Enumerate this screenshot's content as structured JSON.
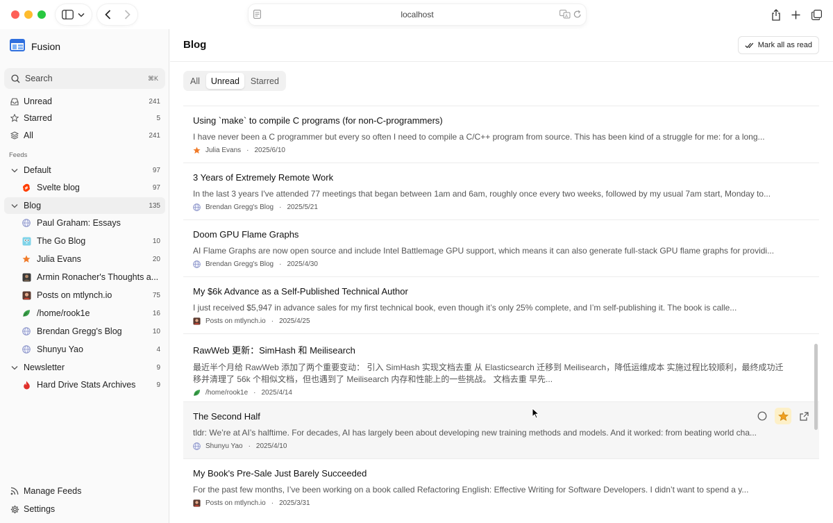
{
  "browser": {
    "url": "localhost"
  },
  "app": {
    "name": "Fusion"
  },
  "search": {
    "label": "Search",
    "shortcut": "⌘K"
  },
  "nav": {
    "unread": {
      "label": "Unread",
      "count": "241"
    },
    "starred": {
      "label": "Starred",
      "count": "5"
    },
    "all": {
      "label": "All",
      "count": "241"
    }
  },
  "feeds_label": "Feeds",
  "groups": [
    {
      "label": "Default",
      "count": "97",
      "feeds": [
        {
          "label": "Svelte blog",
          "count": "97"
        }
      ]
    },
    {
      "label": "Blog",
      "count": "135",
      "feeds": [
        {
          "label": "Paul Graham: Essays",
          "count": ""
        },
        {
          "label": "The Go Blog",
          "count": "10"
        },
        {
          "label": "Julia Evans",
          "count": "20"
        },
        {
          "label": "Armin Ronacher's Thoughts a...",
          "count": ""
        },
        {
          "label": "Posts on mtlynch.io",
          "count": "75"
        },
        {
          "label": "/home/rook1e",
          "count": "16"
        },
        {
          "label": "Brendan Gregg's Blog",
          "count": "10"
        },
        {
          "label": "Shunyu Yao",
          "count": "4"
        }
      ]
    },
    {
      "label": "Newsletter",
      "count": "9",
      "feeds": [
        {
          "label": "Hard Drive Stats Archives",
          "count": "9"
        }
      ]
    }
  ],
  "footer": {
    "manage": "Manage Feeds",
    "settings": "Settings"
  },
  "main": {
    "title": "Blog",
    "mark_all": "Mark all as read",
    "tabs": [
      "All",
      "Unread",
      "Starred"
    ],
    "selected_tab": "Unread"
  },
  "articles": [
    {
      "title": "Using `make` to compile C programs (for non-C-programmers)",
      "summary": "I have never been a C programmer but every so often I need to compile a C/C++ program from source. This has been kind of a struggle for me: for a long...",
      "source": "Julia Evans",
      "date": "2025/6/10"
    },
    {
      "title": "3 Years of Extremely Remote Work",
      "summary": "In the last 3 years I've attended 77 meetings that began between 1am and 6am, roughly once every two weeks, followed by my usual 7am start, Monday to...",
      "source": "Brendan Gregg's Blog",
      "date": "2025/5/21"
    },
    {
      "title": "Doom GPU Flame Graphs",
      "summary": "AI Flame Graphs are now open source and include Intel Battlemage GPU support, which means it can also generate full-stack GPU flame graphs for providi...",
      "source": "Brendan Gregg's Blog",
      "date": "2025/4/30"
    },
    {
      "title": "My $6k Advance as a Self-Published Technical Author",
      "summary": "I just received $5,947 in advance sales for my first technical book, even though it’s only 25% complete, and I’m self-publishing it. The book is calle...",
      "source": "Posts on mtlynch.io",
      "date": "2025/4/25"
    },
    {
      "title": "RawWeb 更新：SimHash 和 Meilisearch",
      "summary": "最近半个月给 RawWeb 添加了两个重要变动： 引入 SimHash 实现文档去重 从 Elasticsearch 迁移到 Meilisearch，降低运维成本 实施过程比较顺利，最终成功迁移并清理了 56k 个相似文档，但也遇到了 Meilisearch 内存和性能上的一些挑战。 文档去重 早先...",
      "source": "/home/rook1e",
      "date": "2025/4/14"
    },
    {
      "title": "The Second Half",
      "summary": "tldr: We’re at AI’s halftime. For decades, AI has largely been about developing new training methods and models. And it worked: from beating world cha...",
      "source": "Shunyu Yao",
      "date": "2025/4/10"
    },
    {
      "title": "My Book's Pre-Sale Just Barely Succeeded",
      "summary": "For the past few months, I’ve been working on a book called Refactoring English: Effective Writing for Software Developers. I didn’t want to spend a y...",
      "source": "Posts on mtlynch.io",
      "date": "2025/3/31"
    }
  ],
  "colors": {
    "accent": "#2f6fde",
    "star": "#f0a020",
    "hover_row": "#f6f6f6"
  }
}
